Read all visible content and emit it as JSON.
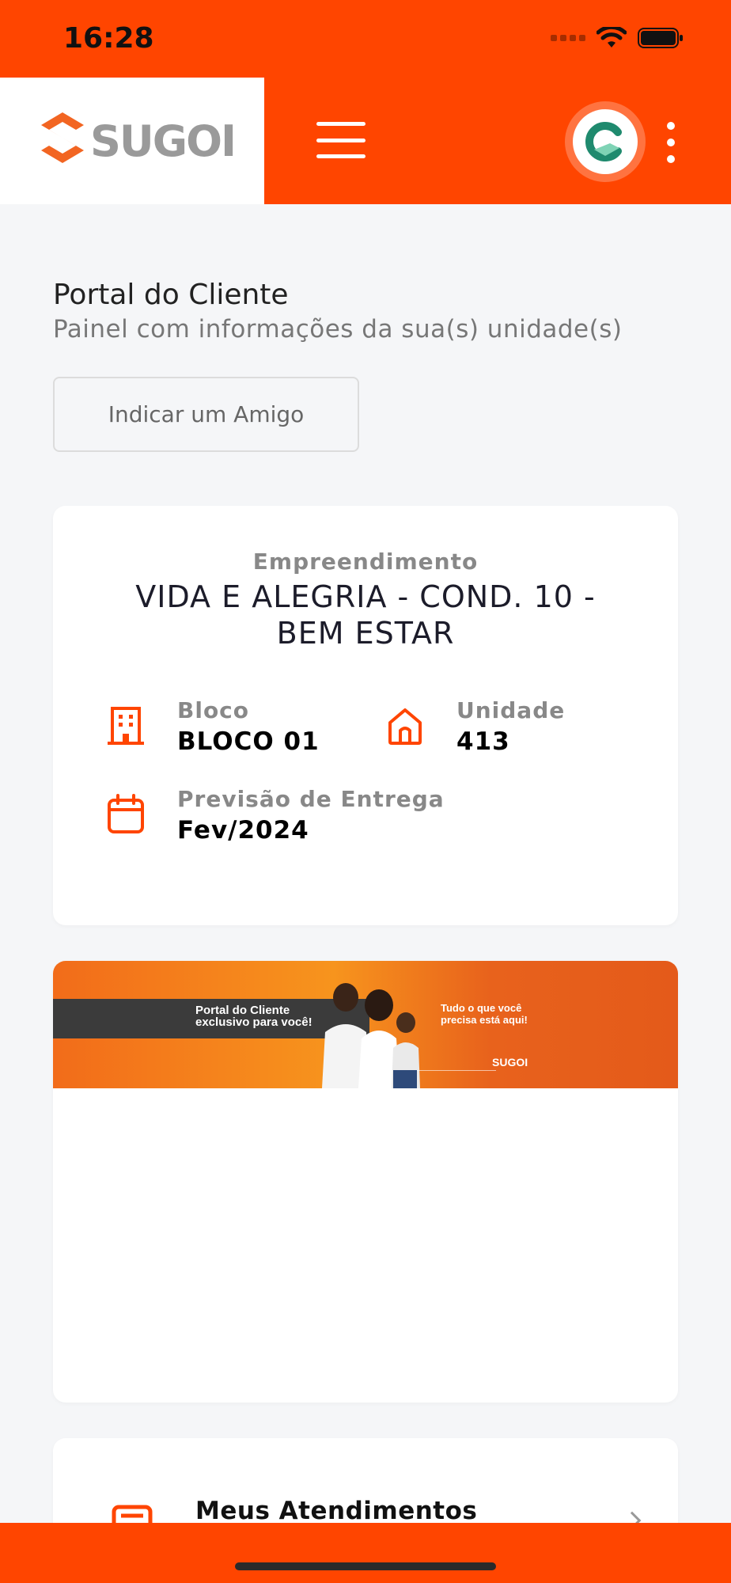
{
  "status_bar": {
    "time": "16:28"
  },
  "header": {
    "logo_text": "SUGOI",
    "brand_color": "#ff4500",
    "menu_icon": "hamburger-icon",
    "avatar_icon": "company-logo-avatar",
    "more_icon": "kebab-icon"
  },
  "page": {
    "title": "Portal do Cliente",
    "subtitle": "Painel com informações da sua(s) unidade(s)",
    "refer_button": "Indicar um Amigo"
  },
  "property": {
    "label": "Empreendimento",
    "name": "VIDA E ALEGRIA - COND. 10 - BEM ESTAR",
    "block": {
      "label": "Bloco",
      "value": "BLOCO 01",
      "icon": "building-icon"
    },
    "unit": {
      "label": "Unidade",
      "value": "413",
      "icon": "home-icon"
    },
    "delivery": {
      "label": "Previsão de Entrega",
      "value": "Fev/2024",
      "icon": "calendar-icon"
    }
  },
  "banner": {
    "left_text": "Portal do Cliente exclusivo para você!",
    "right_text": "Tudo o que você precisa está aqui!",
    "logo_text": "SUGOI"
  },
  "services": {
    "item_label": "Meus Atendimentos",
    "icon": "ticket-icon"
  }
}
